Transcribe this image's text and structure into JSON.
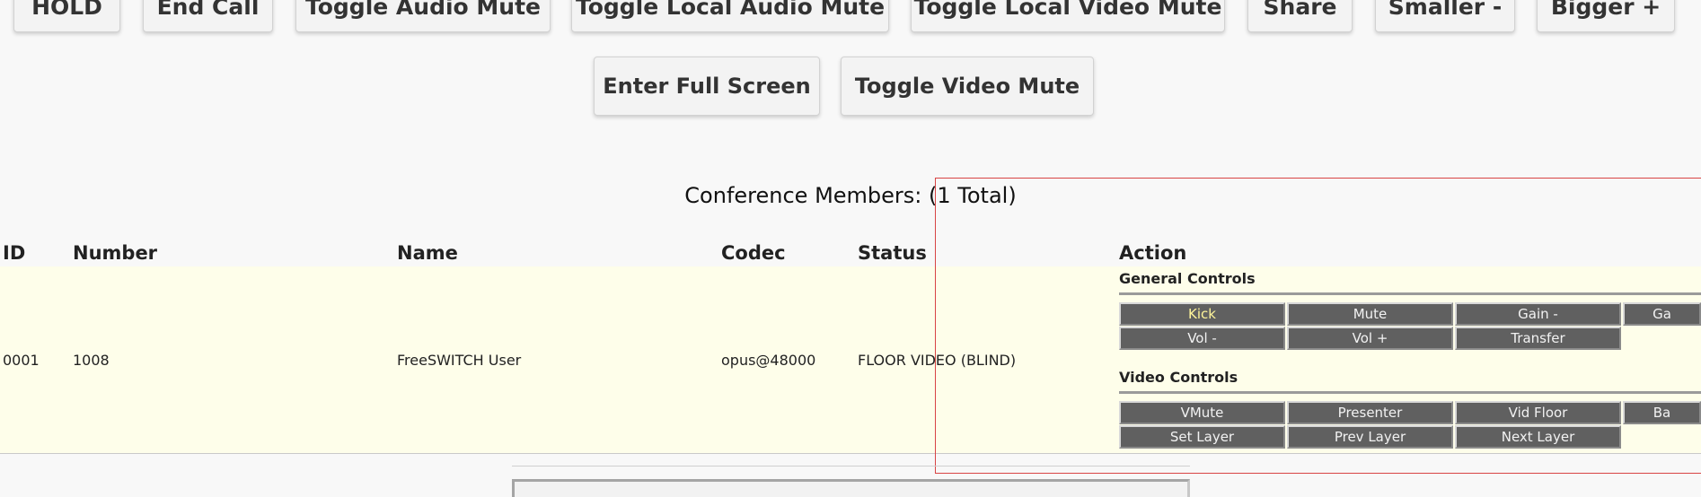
{
  "toolbar": {
    "hold": "HOLD",
    "end_call": "End Call",
    "toggle_audio_mute": "Toggle Audio Mute",
    "toggle_local_audio_mute": "Toggle Local Audio Mute",
    "toggle_local_video_mute": "Toggle Local Video Mute",
    "share": "Share",
    "smaller": "Smaller -",
    "bigger": "Bigger +",
    "enter_full_screen": "Enter Full Screen",
    "toggle_video_mute": "Toggle Video Mute"
  },
  "conference": {
    "title": "Conference Members: (1 Total)",
    "headers": {
      "id": "ID",
      "number": "Number",
      "name": "Name",
      "codec": "Codec",
      "status": "Status",
      "action": "Action"
    },
    "member": {
      "id": "0001",
      "number": "1008",
      "name": "FreeSWITCH User",
      "codec": "opus@48000",
      "status": "FLOOR VIDEO (BLIND)"
    },
    "general_controls": {
      "title": "General Controls",
      "buttons": {
        "kick": "Kick",
        "mute": "Mute",
        "gain_minus": "Gain -",
        "gain_plus": "Ga",
        "vol_minus": "Vol -",
        "vol_plus": "Vol +",
        "transfer": "Transfer"
      }
    },
    "video_controls": {
      "title": "Video Controls",
      "buttons": {
        "vmute": "VMute",
        "presenter": "Presenter",
        "vid_floor": "Vid Floor",
        "banner": "Ba",
        "set_layer": "Set Layer",
        "prev_layer": "Prev Layer",
        "next_layer": "Next Layer"
      }
    }
  },
  "colors": {
    "row_highlight": "#fefeea",
    "control_button": "#606060",
    "kick_text": "#fff59a",
    "overlay_border": "#d84444"
  }
}
